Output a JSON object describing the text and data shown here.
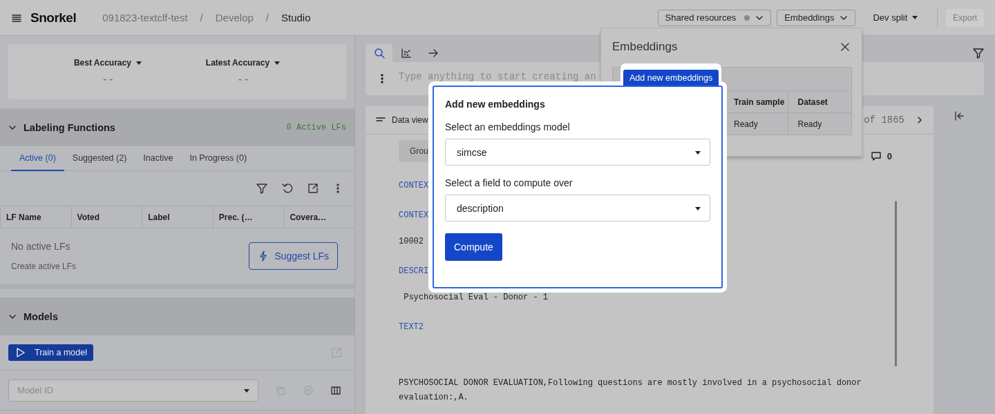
{
  "header": {
    "logo": "Snorkel",
    "breadcrumb": [
      {
        "kind": "link",
        "text": "091823-textclf-test"
      },
      {
        "kind": "separator",
        "text": "/"
      },
      {
        "kind": "link",
        "text": "Develop"
      },
      {
        "kind": "separator",
        "text": "/"
      },
      {
        "kind": "current",
        "text": "Studio"
      }
    ],
    "controls": [
      {
        "kind": "dropdown",
        "label": "Shared resources",
        "status_dot": true,
        "disabled": false
      },
      {
        "kind": "dropdown",
        "label": "Embeddings",
        "status_dot": false,
        "disabled": false
      },
      {
        "kind": "menu",
        "label": "Dev split",
        "status_dot": false,
        "disabled": false
      },
      {
        "kind": "button",
        "label": "Export",
        "status_dot": false,
        "disabled": true
      }
    ]
  },
  "left": {
    "metrics": [
      {
        "label": "Best Accuracy",
        "value": "--"
      },
      {
        "label": "Latest Accuracy",
        "value": "--"
      }
    ],
    "labeling_functions": {
      "title": "Labeling Functions",
      "expanded": true,
      "count": "0 Active LFs",
      "tabs": [
        {
          "label": "Active (0)",
          "selected": true
        },
        {
          "label": "Suggested (2)",
          "selected": false
        },
        {
          "label": "Inactive",
          "selected": false
        },
        {
          "label": "In Progress (0)",
          "selected": false
        }
      ],
      "columns": [
        "LF Name",
        "Voted",
        "Label",
        "Prec. (…",
        "Covera…"
      ],
      "empty_title": "No active LFs",
      "empty_hint": "Create active LFs",
      "suggest_button": "Suggest LFs"
    },
    "models": {
      "title": "Models",
      "expanded": true,
      "train_button": "Train a model",
      "model_select": {
        "placeholder": "Model ID"
      }
    }
  },
  "workspace": {
    "tool_tabs": [
      {
        "kind": "search",
        "selected": true
      },
      {
        "kind": "scatter",
        "selected": false
      },
      {
        "kind": "arrow",
        "selected": false
      }
    ],
    "search": {
      "placeholder": "Type anything to start creating an"
    },
    "data_view": {
      "label": "Data view",
      "filter_chip": "Grou",
      "pager": "of 1865",
      "comment_count": "0",
      "fields": [
        {
          "kind": "key",
          "text": "CONTEX"
        },
        {
          "kind": "key",
          "text": "CONTEX"
        },
        {
          "kind": "value",
          "text": "10002"
        },
        {
          "kind": "key",
          "text": "DESCRI"
        },
        {
          "kind": "value",
          "text": " Psychosocial Eval - Donor - 1"
        },
        {
          "kind": "key",
          "text": "TEXT2"
        },
        {
          "kind": "long_value",
          "text": "PSYCHOSOCIAL DONOR EVALUATION,Following questions are mostly involved in a psychosocial donor evaluation:,A."
        }
      ]
    }
  },
  "embeddings_panel": {
    "title": "Embeddings",
    "columns": [
      "Train sample",
      "Dataset"
    ],
    "rows": [
      [
        "Ready",
        "Ready"
      ]
    ]
  },
  "add_embeddings": {
    "tab": "Add new embeddings",
    "title": "Add new embeddings",
    "model_label": "Select an embeddings model",
    "model_value": "simcse",
    "field_label": "Select a field to compute over",
    "field_value": "description",
    "compute_button": "Compute"
  }
}
